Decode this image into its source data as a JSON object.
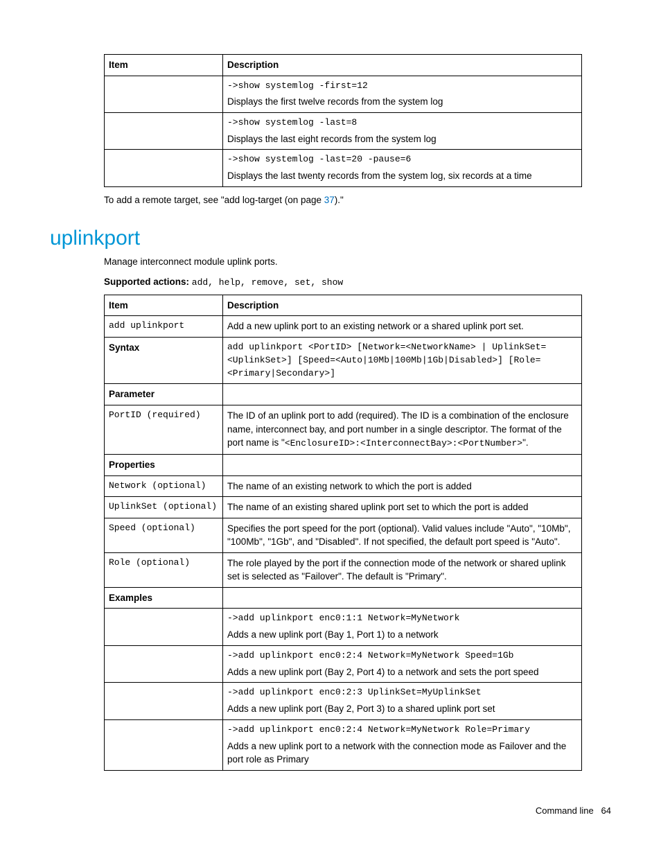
{
  "table1": {
    "headers": {
      "item": "Item",
      "desc": "Description"
    },
    "rows": [
      {
        "cmd": "->show systemlog -first=12",
        "text": "Displays the first twelve records from the system log"
      },
      {
        "cmd": "->show systemlog -last=8",
        "text": "Displays the last eight records from the system log"
      },
      {
        "cmd": "->show systemlog -last=20 -pause=6",
        "text": "Displays the last twenty records from the system log, six records at a time"
      }
    ]
  },
  "note": {
    "pre": "To add a remote target, see \"add log-target (on page ",
    "link": "37",
    "post": ").\""
  },
  "section": {
    "title": "uplinkport",
    "intro": "Manage interconnect module uplink ports.",
    "supported_label": "Supported actions",
    "supported_values": "add, help, remove, set, show"
  },
  "table2": {
    "headers": {
      "item": "Item",
      "desc": "Description"
    },
    "r_add": {
      "item": "add uplinkport",
      "desc": "Add a new uplink port to an existing network or a shared uplink port set."
    },
    "r_syntax": {
      "item": "Syntax",
      "desc": "add uplinkport <PortID> [Network=<NetworkName> | UplinkSet=<UplinkSet>] [Speed=<Auto|10Mb|100Mb|1Gb|Disabled>] [Role=<Primary|Secondary>]"
    },
    "r_param_h": {
      "item": "Parameter"
    },
    "r_portid": {
      "item": "PortID (required)",
      "desc_pre": "The ID of an uplink port to add (required). The ID is a combination of the enclosure name, interconnect bay, and port number in a single descriptor. The format of the port name is \"",
      "desc_mono": "<EnclosureID>:<InterconnectBay>:<PortNumber>",
      "desc_post": "\"."
    },
    "r_props_h": {
      "item": "Properties"
    },
    "r_network": {
      "item": "Network (optional)",
      "desc": "The name of an existing network to which the port is added"
    },
    "r_uplinkset": {
      "item": "UplinkSet (optional)",
      "desc": "The name of an existing shared uplink port set to which the port is added"
    },
    "r_speed": {
      "item": "Speed (optional)",
      "desc": "Specifies the port speed for the port (optional). Valid values include \"Auto\", \"10Mb\", \"100Mb\", \"1Gb\", and \"Disabled\". If not specified, the default port speed is \"Auto\"."
    },
    "r_role": {
      "item": "Role (optional)",
      "desc": "The role played by the port if the connection mode of the network or shared uplink set is selected as \"Failover\". The default is \"Primary\"."
    },
    "r_ex_h": {
      "item": "Examples"
    },
    "ex1": {
      "cmd": "->add uplinkport enc0:1:1 Network=MyNetwork",
      "text": "Adds a new uplink port (Bay 1, Port  1) to a network"
    },
    "ex2": {
      "cmd": "->add uplinkport enc0:2:4 Network=MyNetwork Speed=1Gb",
      "text": "Adds a new uplink port (Bay 2, Port 4) to a network and sets the port speed"
    },
    "ex3": {
      "cmd": "->add uplinkport enc0:2:3 UplinkSet=MyUplinkSet",
      "text": "Adds a new uplink port (Bay 2, Port 3) to a shared uplink port set"
    },
    "ex4": {
      "cmd": "->add uplinkport enc0:2:4 Network=MyNetwork Role=Primary",
      "text": "Adds a new uplink port to a network with the connection mode as Failover and the port role as Primary"
    }
  },
  "footer": {
    "label": "Command line",
    "page": "64"
  }
}
